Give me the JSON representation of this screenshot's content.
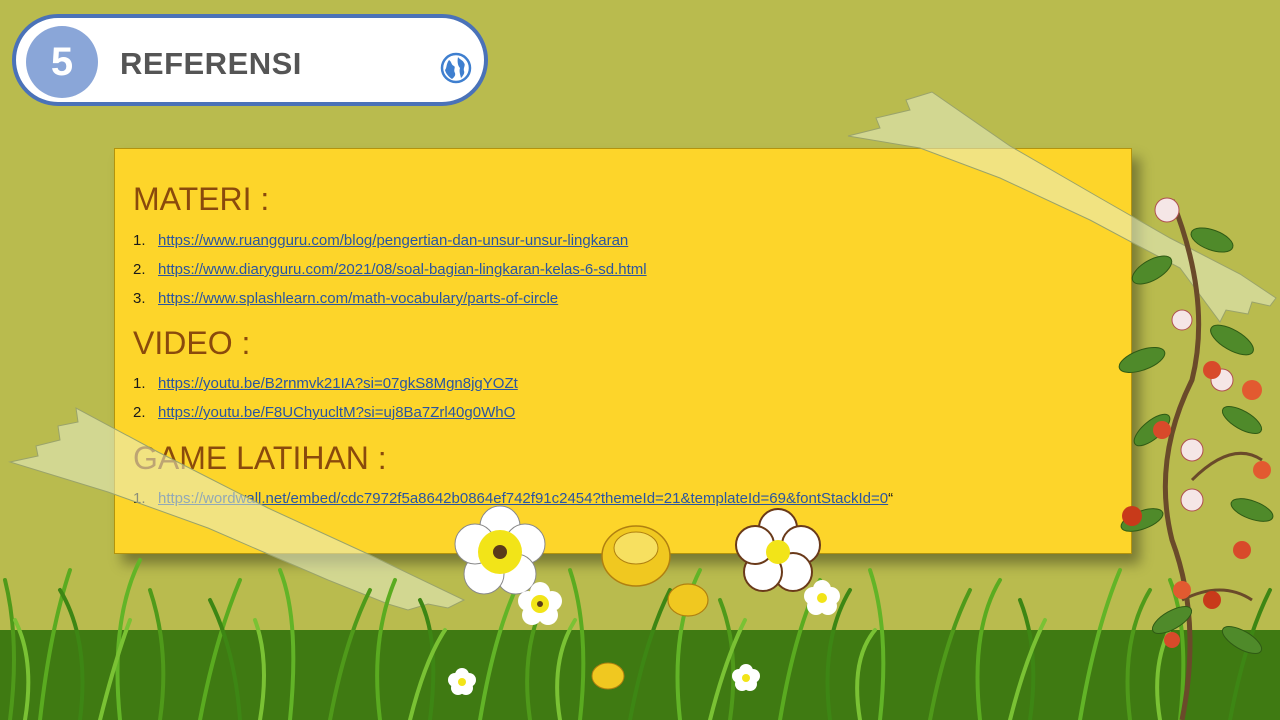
{
  "header": {
    "number": "5",
    "title": "REFERENSI",
    "icon": "globe-icon"
  },
  "sections": [
    {
      "heading": "MATERI :",
      "items": [
        {
          "num": "1.",
          "url": "https://www.ruangguru.com/blog/pengertian-dan-unsur-unsur-lingkaran"
        },
        {
          "num": "2.",
          "url": "https://www.diaryguru.com/2021/08/soal-bagian-lingkaran-kelas-6-sd.html"
        },
        {
          "num": "3.",
          "url": "https://www.splashlearn.com/math-vocabulary/parts-of-circle"
        }
      ]
    },
    {
      "heading": "VIDEO :",
      "items": [
        {
          "num": "1.",
          "url": "https://youtu.be/B2rnmvk21IA?si=07gkS8Mgn8jgYOZt"
        },
        {
          "num": "2.",
          "url": "https://youtu.be/F8UChyucltM?si=uj8Ba7Zrl40g0WhO"
        }
      ]
    },
    {
      "heading": "GAME LATIHAN :",
      "items": [
        {
          "num": "1.",
          "url": "https://wordwall.net/embed/cdc7972f5a8642b0864ef742f91c2454?themeId=21&templateId=69&fontStackId=0",
          "suffix": "“"
        }
      ]
    }
  ],
  "colors": {
    "background": "#b9bb4e",
    "note": "#fdd52a",
    "heading": "#8a4a0c",
    "link": "#2a55a0",
    "pill_border": "#4a72b8",
    "number_circle": "#8aa6d8"
  }
}
